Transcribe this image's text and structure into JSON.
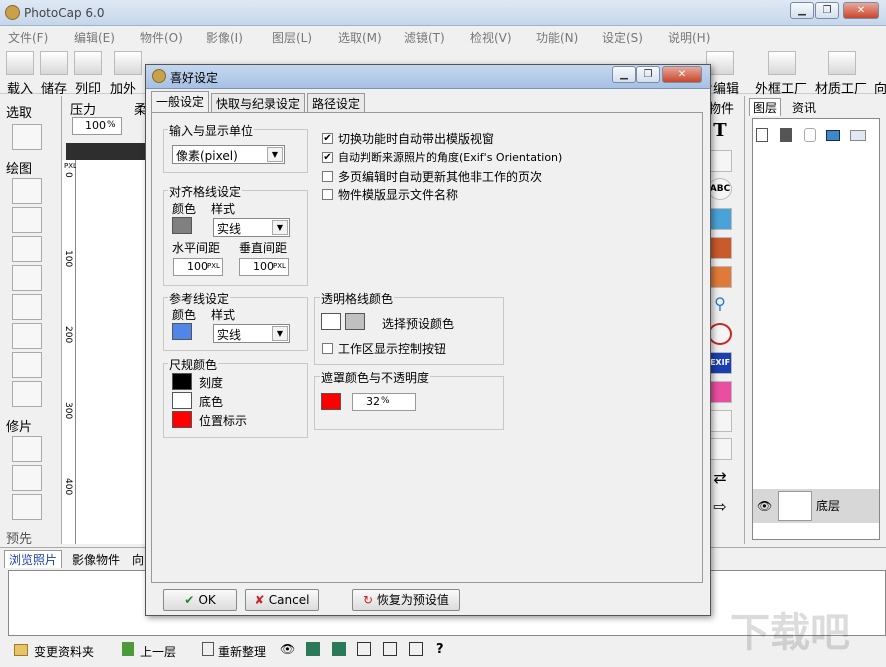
{
  "app": {
    "title": "PhotoCap 6.0"
  },
  "menu": [
    "文件(F)",
    "编辑(E)",
    "物件(O)",
    "影像(I)",
    "图层(L)",
    "选取(M)",
    "滤镜(T)",
    "检视(V)",
    "功能(N)",
    "设定(S)",
    "说明(H)"
  ],
  "toolbar": {
    "left_labels": [
      "载入",
      "储存",
      "列印",
      "加外"
    ],
    "right_labels": [
      "片编辑",
      "外框工厂",
      "材质工厂",
      "向"
    ]
  },
  "left_pane": {
    "select_label": "选取",
    "draw_label": "绘图",
    "retouch_label": "修片",
    "bottom_label": "预先"
  },
  "options": {
    "pressure_label": "压力",
    "soft_label": "柔",
    "pressure_value": "100",
    "pressure_unit": "%"
  },
  "ruler": {
    "unit": "PXL",
    "ticks": [
      "0",
      "100",
      "200",
      "300",
      "400"
    ]
  },
  "right_panel": {
    "objects_label": "物件",
    "tab_layers": "图层",
    "tab_info": "资讯",
    "layer_name": "底层"
  },
  "bottom_tabs": [
    "浏览照片",
    "影像物件",
    "向"
  ],
  "statusbar": {
    "change_folder": "变更资料夹",
    "up_level": "上一层",
    "refresh": "重新整理",
    "help": "?"
  },
  "watermark": "下载吧",
  "dialog": {
    "title": "喜好设定",
    "tabs": [
      "一般设定",
      "快取与纪录设定",
      "路径设定"
    ],
    "unit_group": {
      "label": "输入与显示单位",
      "value": "像素(pixel)"
    },
    "grid_group": {
      "label": "对齐格线设定",
      "color_label": "颜色",
      "style_label": "样式",
      "style_value": "实线",
      "h_label": "水平间距",
      "v_label": "垂直间距",
      "h_value": "100",
      "v_value": "100",
      "unit": "PXL",
      "color": "#808080"
    },
    "guide_group": {
      "label": "参考线设定",
      "color_label": "颜色",
      "style_label": "样式",
      "style_value": "实线",
      "color": "#4f86e8"
    },
    "ruler_group": {
      "label": "尺规颜色",
      "items": [
        {
          "label": "刻度",
          "color": "#000000"
        },
        {
          "label": "底色",
          "color": "#ffffff"
        },
        {
          "label": "位置标示",
          "color": "#ff0000"
        }
      ]
    },
    "checks": [
      {
        "label": "切换功能时自动带出模版视窗",
        "checked": "✔"
      },
      {
        "label": "自动判断来源照片的角度(Exif's Orientation)",
        "checked": "✔"
      },
      {
        "label": "多页编辑时自动更新其他非工作的页次",
        "checked": ""
      },
      {
        "label": "物件模版显示文件名称",
        "checked": ""
      }
    ],
    "transparent_group": {
      "label": "透明格线颜色",
      "select_label": "选择预设颜色",
      "check_label": "工作区显示控制按钮",
      "color1": "#ffffff",
      "color2": "#c0c0c0"
    },
    "mask_group": {
      "label": "遮罩颜色与不透明度",
      "color": "#ff0000",
      "opacity": "32",
      "unit": "%"
    },
    "buttons": {
      "ok": "OK",
      "cancel": "Cancel",
      "reset": "恢复为预设值"
    }
  }
}
